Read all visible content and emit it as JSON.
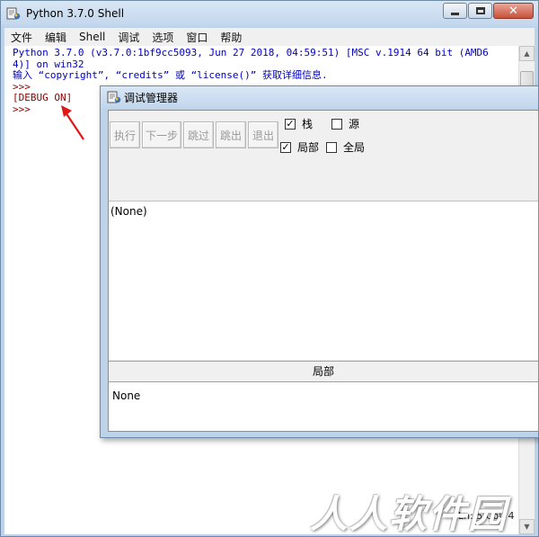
{
  "shell": {
    "title": "Python 3.7.0 Shell",
    "menu": [
      "文件",
      "编辑",
      "Shell",
      "调试",
      "选项",
      "窗口",
      "帮助"
    ],
    "lines": [
      {
        "text": "Python 3.7.0 (v3.7.0:1bf9cc5093, Jun 27 2018, 04:59:51) [MSC v.1914 64 bit (AMD6",
        "kind": "out"
      },
      {
        "text": "4)] on win32",
        "kind": "out"
      },
      {
        "text": "输入 “copyright”, “credits” 或 “license()” 获取详细信息.",
        "kind": "out"
      },
      {
        "text": ">>> ",
        "kind": "prompt"
      },
      {
        "text": "[DEBUG ON]",
        "kind": "prompt"
      },
      {
        "text": ">>> ",
        "kind": "prompt"
      }
    ],
    "status": "Ln: 5  Col: 4"
  },
  "debug": {
    "title": "调试管理器",
    "buttons": [
      "执行",
      "下一步",
      "跳过",
      "跳出",
      "退出"
    ],
    "checkboxes": {
      "stack": {
        "label": "栈",
        "checked": true
      },
      "source": {
        "label": "源",
        "checked": false
      },
      "locals": {
        "label": "局部",
        "checked": true
      },
      "globals": {
        "label": "全局",
        "checked": false
      }
    },
    "stack_text": "(None)",
    "locals_header": "局部",
    "locals_text": "None"
  },
  "watermark": "人人软件园",
  "colors": {
    "output": "#0000c0",
    "prompt": "#8b0000",
    "arrow": "#e01818"
  }
}
